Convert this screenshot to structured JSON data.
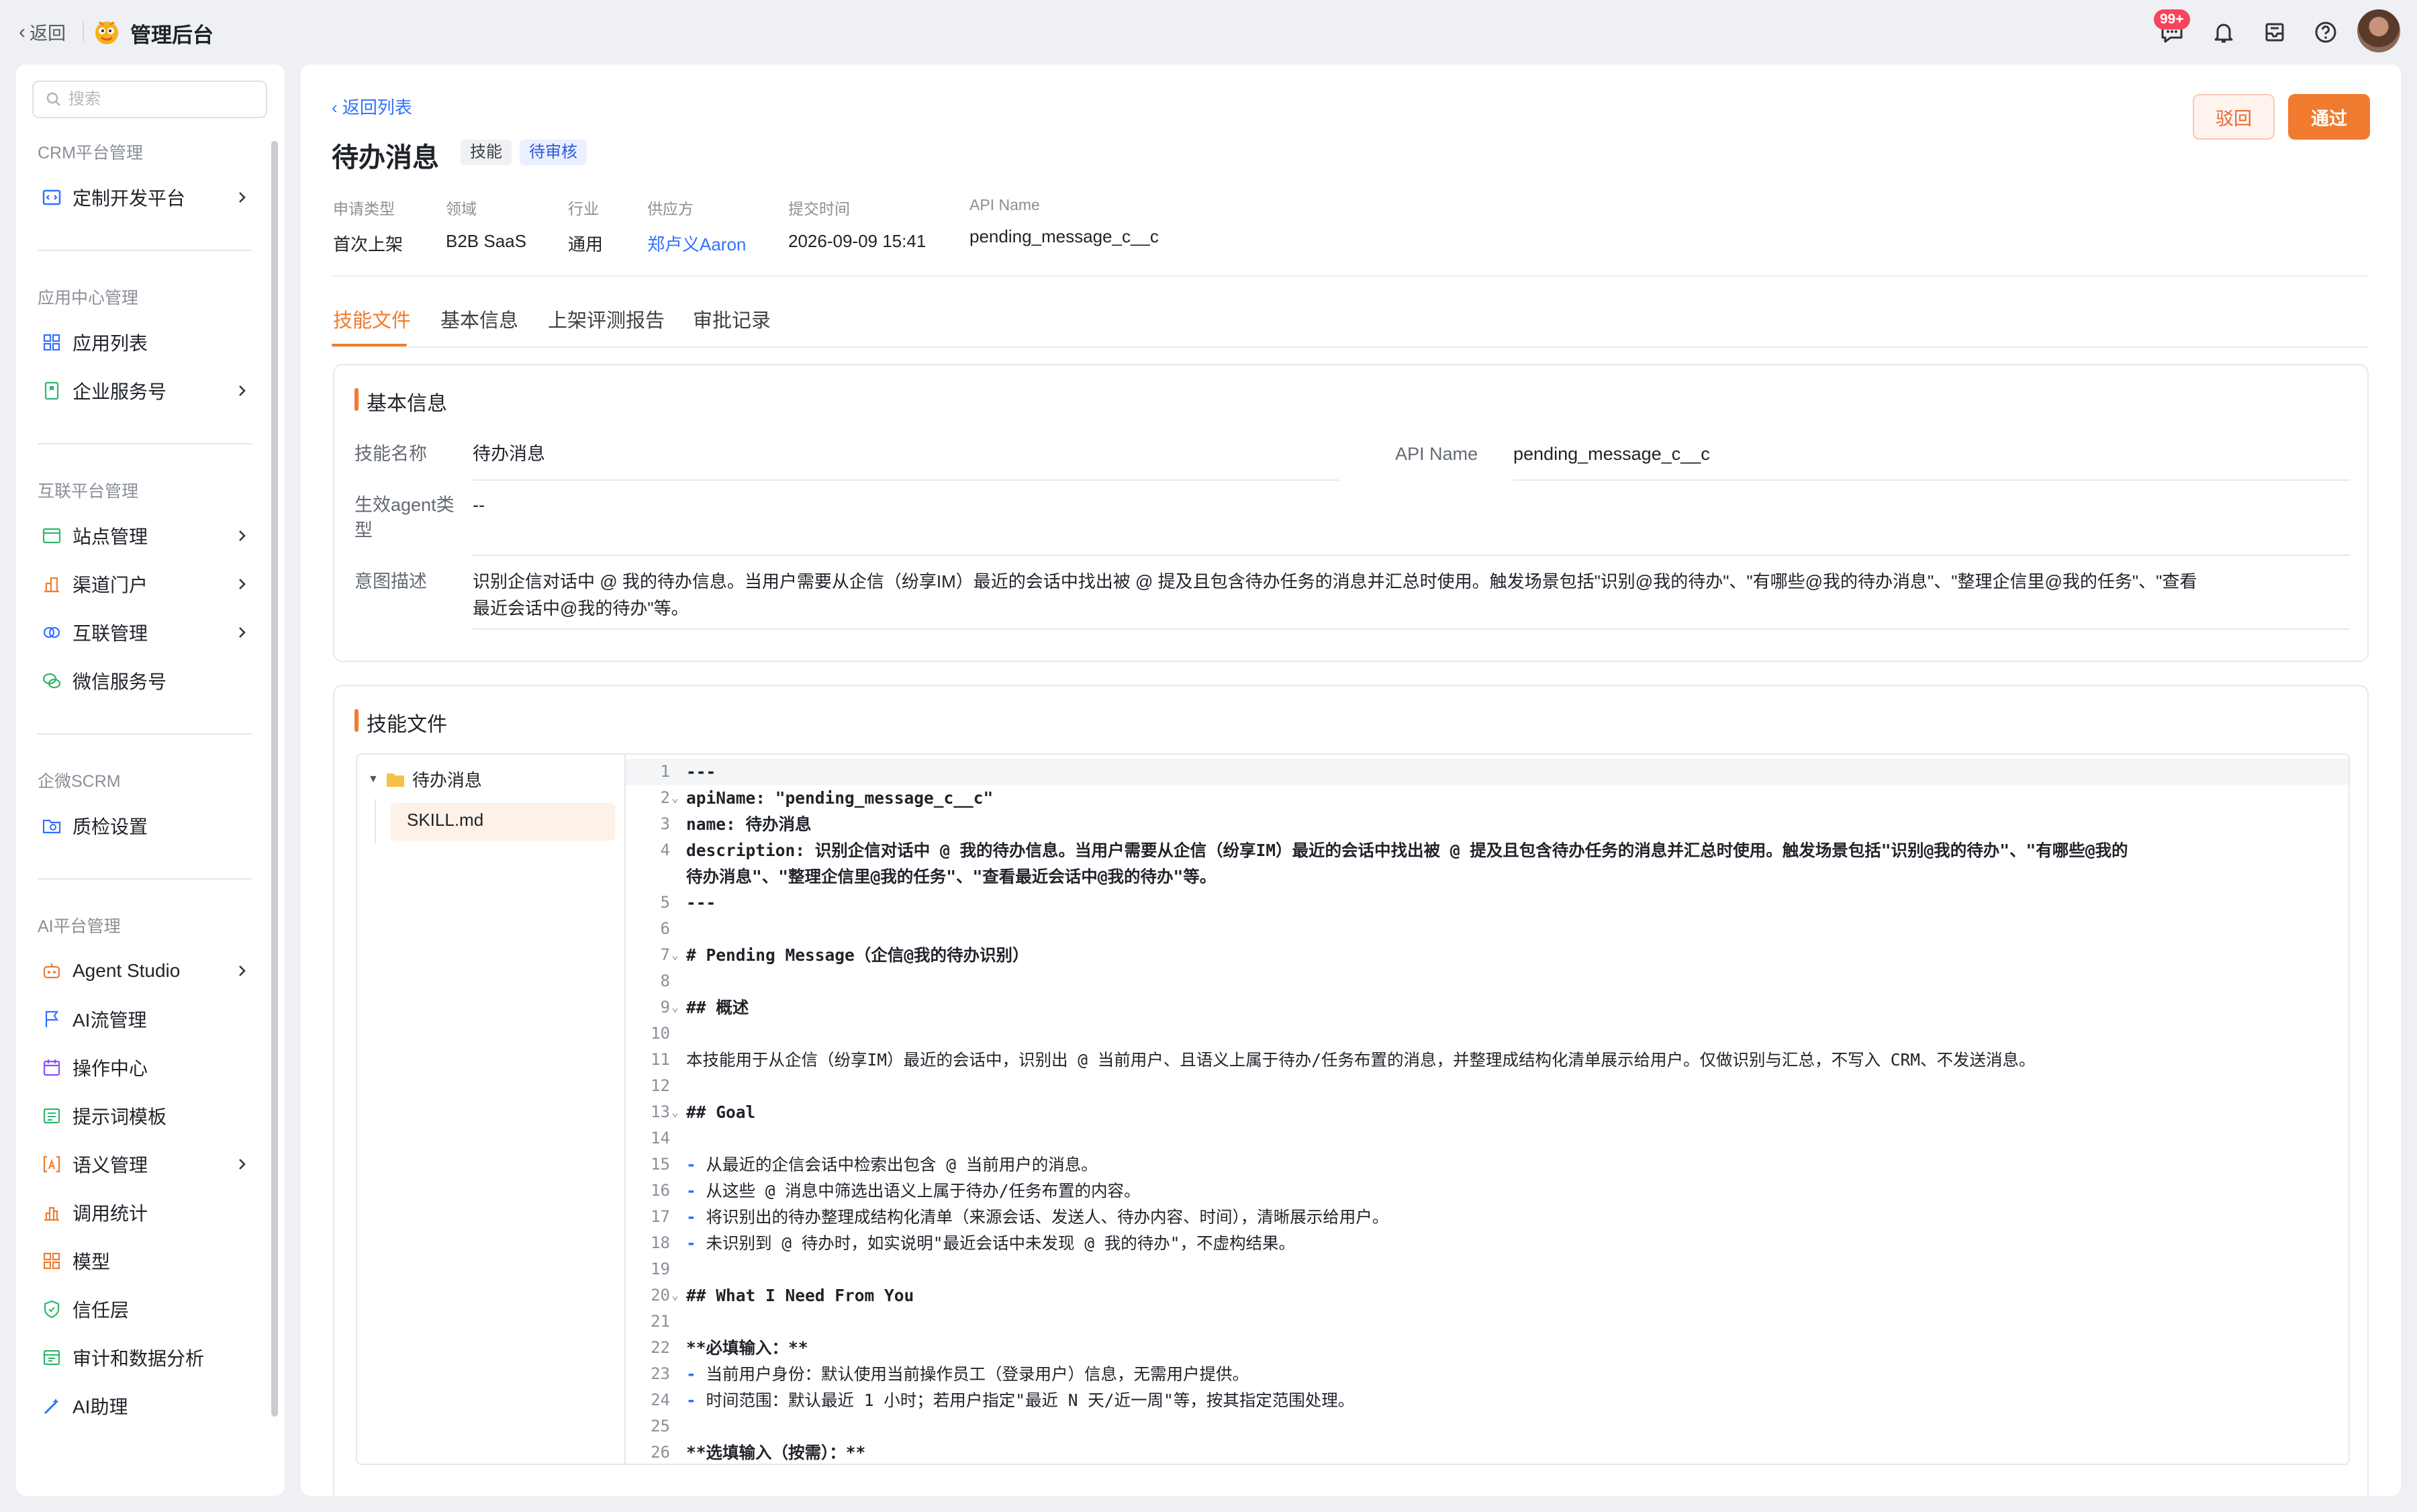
{
  "topbar": {
    "back_label": "返回",
    "app_title": "管理后台",
    "notification_badge": "99+"
  },
  "sidebar": {
    "search_placeholder": "搜索",
    "groups": [
      {
        "title": "CRM平台管理",
        "items": [
          {
            "label": "定制开发平台",
            "icon": "code-window-icon",
            "has_arrow": true
          }
        ]
      },
      {
        "title": "应用中心管理",
        "items": [
          {
            "label": "应用列表",
            "icon": "grid-icon",
            "has_arrow": false
          },
          {
            "label": "企业服务号",
            "icon": "bookmark-icon",
            "has_arrow": true
          }
        ]
      },
      {
        "title": "互联平台管理",
        "items": [
          {
            "label": "站点管理",
            "icon": "site-icon",
            "has_arrow": true
          },
          {
            "label": "渠道门户",
            "icon": "building-icon",
            "has_arrow": true
          },
          {
            "label": "互联管理",
            "icon": "link-icon",
            "has_arrow": true
          },
          {
            "label": "微信服务号",
            "icon": "wechat-icon",
            "has_arrow": false
          }
        ]
      },
      {
        "title": "企微SCRM",
        "items": [
          {
            "label": "质检设置",
            "icon": "folder-search-icon",
            "has_arrow": false
          }
        ]
      },
      {
        "title": "AI平台管理",
        "items": [
          {
            "label": "Agent Studio",
            "icon": "robot-icon",
            "has_arrow": true
          },
          {
            "label": "AI流管理",
            "icon": "flag-icon",
            "has_arrow": false
          },
          {
            "label": "操作中心",
            "icon": "calendar-icon",
            "has_arrow": false
          },
          {
            "label": "提示词模板",
            "icon": "template-icon",
            "has_arrow": false
          },
          {
            "label": "语义管理",
            "icon": "bracket-a-icon",
            "has_arrow": true
          },
          {
            "label": "调用统计",
            "icon": "bar-stat-icon",
            "has_arrow": false
          },
          {
            "label": "模型",
            "icon": "model-icon",
            "has_arrow": false
          },
          {
            "label": "信任层",
            "icon": "shield-icon",
            "has_arrow": false
          },
          {
            "label": "审计和数据分析",
            "icon": "audit-icon",
            "has_arrow": false
          },
          {
            "label": "AI助理",
            "icon": "ai-wand-icon",
            "has_arrow": false
          }
        ]
      }
    ],
    "collapse_icon": "double-chevron-left-icon"
  },
  "header": {
    "back_to_list": "‹ 返回列表",
    "title": "待办消息",
    "tag_type": "技能",
    "tag_status": "待审核",
    "reject_label": "驳回",
    "approve_label": "通过"
  },
  "meta": [
    {
      "key": "申请类型",
      "value": "首次上架"
    },
    {
      "key": "领域",
      "value": "B2B SaaS"
    },
    {
      "key": "行业",
      "value": "通用"
    },
    {
      "key": "供应方",
      "value": "郑卢义Aaron"
    },
    {
      "key": "提交时间",
      "value": "2026-09-09 15:41"
    },
    {
      "key": "API Name",
      "value": "pending_message_c__c"
    }
  ],
  "tabs": [
    "技能文件",
    "基本信息",
    "上架评测报告",
    "审批记录"
  ],
  "basic_info": {
    "title": "基本信息",
    "skill_name_label": "技能名称",
    "skill_name": "待办消息",
    "api_name_label": "API Name",
    "api_name": "pending_message_c__c",
    "agent_type_label_1": "生效agent类",
    "agent_type_label_2": "型",
    "agent_type": "--",
    "intent_label": "意图描述",
    "intent_line1": "识别企信对话中 @ 我的待办信息。当用户需要从企信（纷享IM）最近的会话中找出被 @ 提及且包含待办任务的消息并汇总时使用。触发场景包括\"识别@我的待办\"、\"有哪些@我的待办消息\"、\"整理企信里@我的任务\"、\"查看",
    "intent_line2": "最近会话中@我的待办\"等。"
  },
  "skill_files": {
    "title": "技能文件",
    "folder": "待办消息",
    "file": "SKILL.md",
    "lines": [
      {
        "n": "1",
        "t": "---",
        "b": true
      },
      {
        "n": "2",
        "t": "apiName: \"pending_message_c__c\"",
        "b": true,
        "fold": true
      },
      {
        "n": "3",
        "t": "name: 待办消息",
        "b": true
      },
      {
        "n": "4",
        "t": "description: 识别企信对话中 @ 我的待办信息。当用户需要从企信（纷享IM）最近的会话中找出被 @ 提及且包含待办任务的消息并汇总时使用。触发场景包括\"识别@我的待办\"、\"有哪些@我的",
        "b": true
      },
      {
        "n": "",
        "t": "待办消息\"、\"整理企信里@我的任务\"、\"查看最近会话中@我的待办\"等。",
        "b": true
      },
      {
        "n": "5",
        "t": "---",
        "b": true
      },
      {
        "n": "6",
        "t": ""
      },
      {
        "n": "7",
        "t": "# Pending Message（企信@我的待办识别）",
        "b": true,
        "fold": true
      },
      {
        "n": "8",
        "t": ""
      },
      {
        "n": "9",
        "t": "## 概述",
        "b": true,
        "fold": true
      },
      {
        "n": "10",
        "t": ""
      },
      {
        "n": "11",
        "t": "本技能用于从企信（纷享IM）最近的会话中，识别出 @ 当前用户、且语义上属于待办/任务布置的消息，并整理成结构化清单展示给用户。仅做识别与汇总，不写入 CRM、不发送消息。"
      },
      {
        "n": "12",
        "t": ""
      },
      {
        "n": "13",
        "t": "## Goal",
        "b": true,
        "fold": true
      },
      {
        "n": "14",
        "t": ""
      },
      {
        "n": "15",
        "t": "从最近的企信会话中检索出包含 @ 当前用户的消息。",
        "dash": true
      },
      {
        "n": "16",
        "t": "从这些 @ 消息中筛选出语义上属于待办/任务布置的内容。",
        "dash": true
      },
      {
        "n": "17",
        "t": "将识别出的待办整理成结构化清单（来源会话、发送人、待办内容、时间），清晰展示给用户。",
        "dash": true
      },
      {
        "n": "18",
        "t": "未识别到 @ 待办时，如实说明\"最近会话中未发现 @ 我的待办\"，不虚构结果。",
        "dash": true
      },
      {
        "n": "19",
        "t": ""
      },
      {
        "n": "20",
        "t": "## What I Need From You",
        "b": true,
        "fold": true
      },
      {
        "n": "21",
        "t": ""
      },
      {
        "n": "22",
        "t": "**必填输入：**",
        "b": true
      },
      {
        "n": "23",
        "t": "当前用户身份：默认使用当前操作员工（登录用户）信息，无需用户提供。",
        "dash": true
      },
      {
        "n": "24",
        "t": "时间范围：默认最近 1 小时；若用户指定\"最近 N 天/近一周\"等，按其指定范围处理。",
        "dash": true
      },
      {
        "n": "25",
        "t": ""
      },
      {
        "n": "26",
        "t": "**选填输入（按需）：**",
        "b": true
      }
    ]
  }
}
